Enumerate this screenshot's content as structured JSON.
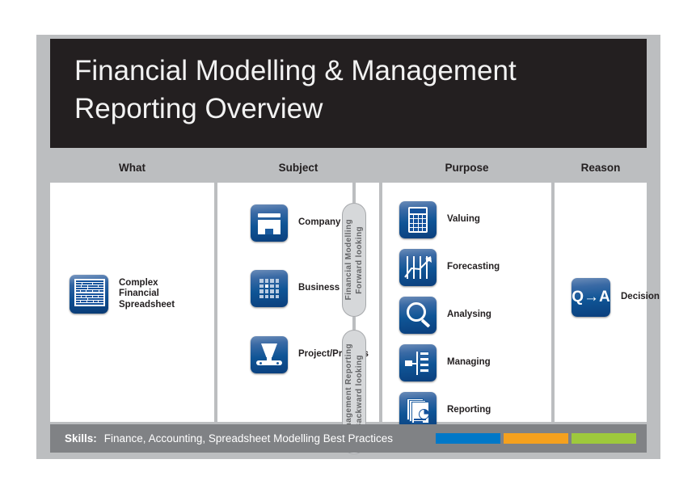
{
  "title": {
    "line1": "Financial Modelling & Management",
    "line2": "Reporting Overview"
  },
  "columns": [
    {
      "header": "What"
    },
    {
      "header": "Subject"
    },
    {
      "header": "Purpose"
    },
    {
      "header": "Reason"
    }
  ],
  "what": {
    "items": [
      {
        "label": "Complex\nFinancial\nSpreadsheet",
        "icon": "spreadsheet-icon"
      }
    ]
  },
  "subject": {
    "items": [
      {
        "label": "Company",
        "icon": "company-icon"
      },
      {
        "label": "Business Unit",
        "icon": "business-unit-grid-icon"
      },
      {
        "label": "Project/Process",
        "icon": "project-process-icon"
      }
    ]
  },
  "purpose": {
    "items": [
      {
        "label": "Valuing",
        "icon": "calculator-icon"
      },
      {
        "label": "Forecasting",
        "icon": "trend-chart-icon"
      },
      {
        "label": "Analysing",
        "icon": "magnifier-icon"
      },
      {
        "label": "Managing",
        "icon": "org-chart-icon"
      },
      {
        "label": "Reporting",
        "icon": "documents-pie-icon"
      }
    ]
  },
  "reason": {
    "items": [
      {
        "label": "Decision",
        "icon": "question-to-answer-icon",
        "icon_text": "Q→A"
      }
    ]
  },
  "pills": [
    {
      "line1": "Financial Modelling",
      "line2": "Forward looking"
    },
    {
      "line1": "Management Reporting",
      "line2": "Backward looking"
    }
  ],
  "skills": {
    "key": "Skills:",
    "value": "Finance, Accounting, Spreadsheet Modelling Best Practices",
    "chips": [
      {
        "name": "chip-blue",
        "color": "#0078c8"
      },
      {
        "name": "chip-orange",
        "color": "#f5a11e"
      },
      {
        "name": "chip-green",
        "color": "#9ec93c"
      }
    ]
  },
  "colors": {
    "frame": "#bcbec0",
    "title_bg": "#231f20",
    "header_bg": "#bcbec0",
    "panel_bg": "#ffffff",
    "skills_bg": "#808285",
    "pill_bg": "#d6d8da",
    "pill_border": "#a6a8ab",
    "icon_blue_light": "#6b8cb8",
    "icon_blue_dark": "#0b3f7d"
  }
}
